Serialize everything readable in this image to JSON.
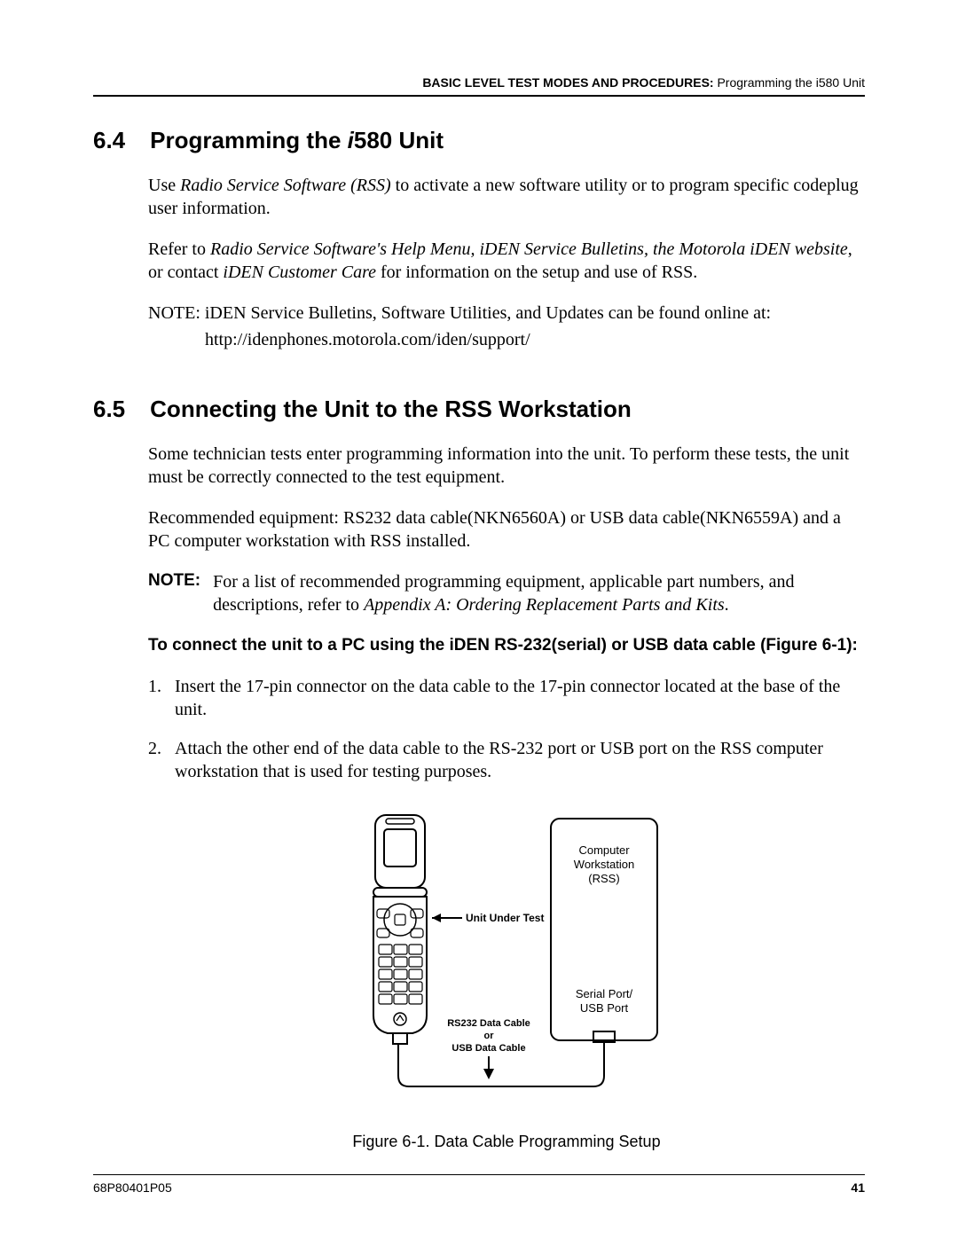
{
  "header": {
    "bold": "BASIC LEVEL TEST MODES AND PROCEDURES:",
    "plain": "  Programming the i580 Unit"
  },
  "s64": {
    "num": "6.4",
    "title_prefix": "Programming the ",
    "title_ital": "i",
    "title_suffix": "580 Unit",
    "p1_a": "Use ",
    "p1_ital": "Radio Service Software (RSS)",
    "p1_b": " to activate a new software utility or to program specific codeplug user information.",
    "p2_a": "Refer to ",
    "p2_ital": "Radio Service Software's Help Menu, iDEN Service Bulletins, the Motorola iDEN website",
    "p2_b": ", or contact ",
    "p2_ital2": "iDEN Customer Care",
    "p2_c": " for information on the setup and use of RSS.",
    "note_line": "NOTE: iDEN Service Bulletins, Software Utilities, and Updates can be found online at:",
    "note_url": "http://idenphones.motorola.com/iden/support/"
  },
  "s65": {
    "num": "6.5",
    "title": "Connecting the Unit to the RSS Workstation",
    "p1": "Some technician tests enter programming information into the unit. To perform these tests, the unit must be correctly connected to the test equipment.",
    "p2": "Recommended equipment: RS232 data cable(NKN6560A) or USB data cable(NKN6559A) and a PC computer workstation with RSS installed.",
    "note_label": "NOTE:",
    "note_a": "For a list of recommended programming equipment, applicable part numbers, and descriptions, refer to ",
    "note_ital": "Appendix A: Ordering Replacement Parts and Kits",
    "note_b": ".",
    "subhead": "To connect the unit to a PC using the iDEN RS-232(serial) or USB data cable (Figure 6-1):",
    "steps": [
      "Insert the 17-pin connector on the data cable to the 17-pin connector located at the base of the unit.",
      "Attach the other end of the data cable to the RS-232 port or USB port on the RSS computer workstation that is used for testing purposes."
    ]
  },
  "figure": {
    "label_unit": "Unit Under Test",
    "label_rs232": "RS232 Data Cable",
    "label_or": "or",
    "label_usb": "USB Data Cable",
    "box_top1": "Computer",
    "box_top2": "Workstation",
    "box_top3": "(RSS)",
    "box_bot1": "Serial Port/",
    "box_bot2": "USB Port",
    "caption": "Figure 6-1. Data Cable Programming Setup"
  },
  "footer": {
    "docnum": "68P80401P05",
    "page": "41"
  }
}
